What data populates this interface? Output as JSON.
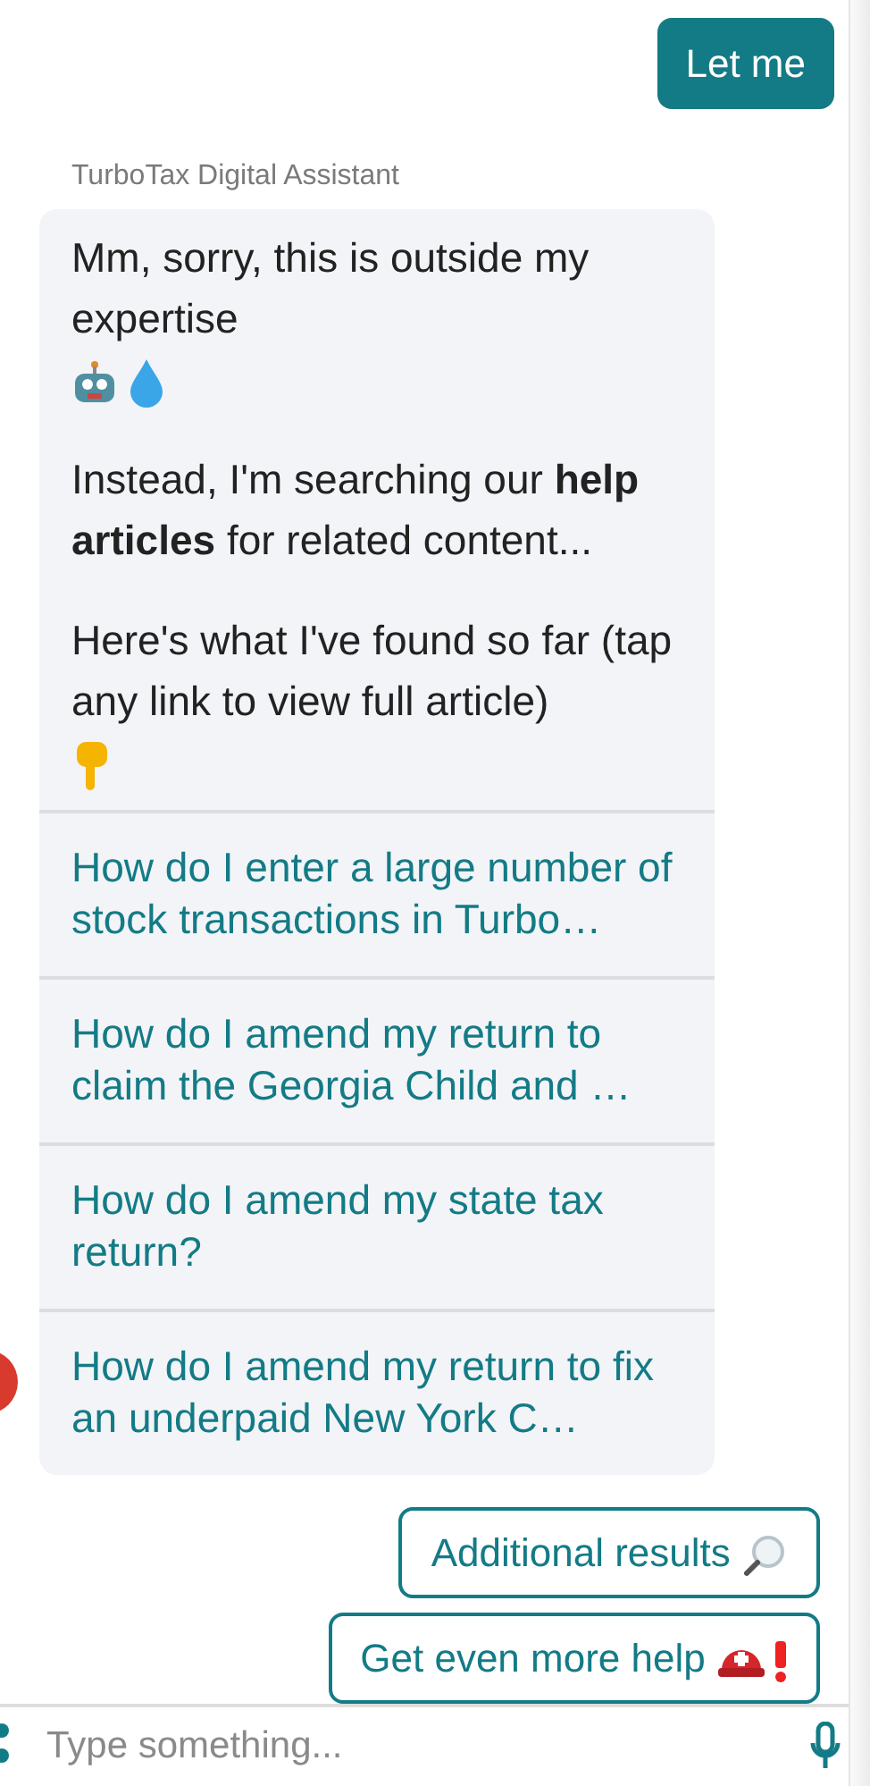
{
  "user_message": {
    "text": "Let me"
  },
  "assistant": {
    "sender": "TurboTax Digital Assistant",
    "paragraphs": [
      "Mm, sorry, this is outside my expertise",
      "Instead, I'm searching our **help articles** for related content...",
      "Here's what I've found so far (tap any link to view full article)"
    ],
    "links": [
      "How do I enter a large number of stock transactions in Turbo…",
      "How do I amend my return to claim the Georgia Child and …",
      "How do I amend my state tax return?",
      "How do I amend my return to fix an underpaid New York C…"
    ]
  },
  "quick_replies": [
    {
      "label": "Additional results",
      "kind": "search"
    },
    {
      "label": "Get even more help",
      "kind": "help"
    }
  ],
  "composer": {
    "placeholder": "Type something..."
  }
}
